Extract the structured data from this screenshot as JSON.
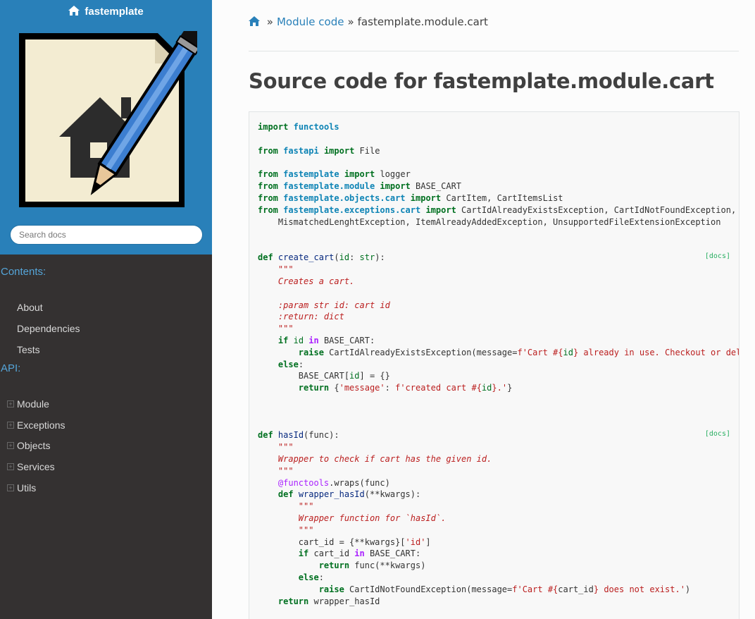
{
  "sidebar": {
    "brand": "fastemplate",
    "search_placeholder": "Search docs",
    "captions": [
      "Contents:",
      "API:"
    ],
    "contents": [
      "About",
      "Dependencies",
      "Tests"
    ],
    "api": [
      "Module",
      "Exceptions",
      "Objects",
      "Services",
      "Utils"
    ]
  },
  "breadcrumb": {
    "sep1": "»",
    "link": "Module code",
    "sep2": "»",
    "current": "fastemplate.module.cart"
  },
  "title": "Source code for fastemplate.module.cart",
  "docs_label": "[docs]",
  "colors": {
    "accent": "#2980b9",
    "sidebar_bg": "#343131",
    "nav_caption": "#55a5d9",
    "docs_link": "#27ae60"
  },
  "icons": [
    "home-icon",
    "logo-pencil-image",
    "expand-icon"
  ]
}
